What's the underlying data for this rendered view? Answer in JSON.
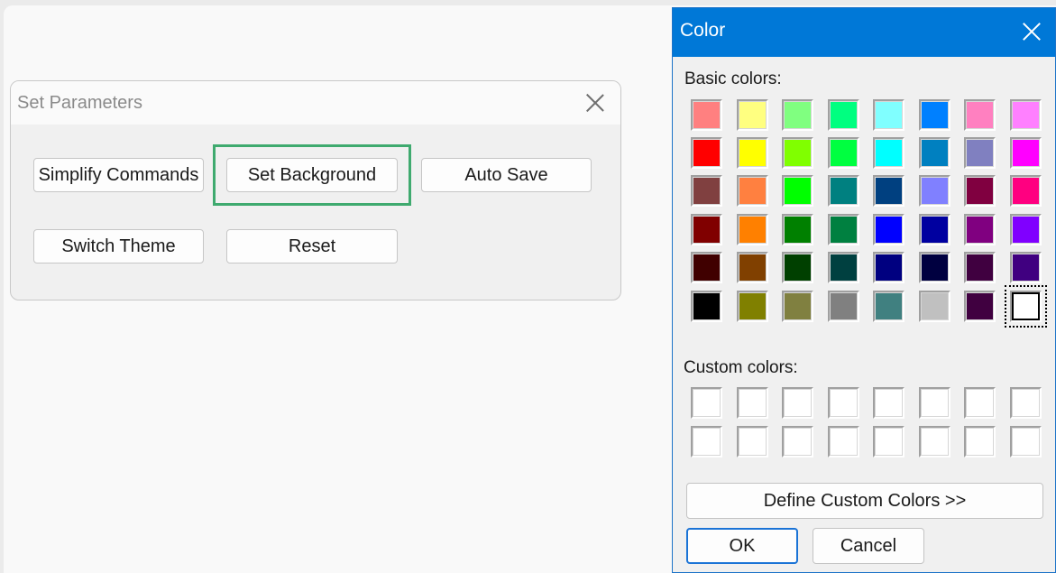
{
  "params_dialog": {
    "title": "Set Parameters",
    "buttons": {
      "simplify": "Simplify Commands",
      "background": "Set Background",
      "autosave": "Auto Save",
      "theme": "Switch Theme",
      "reset": "Reset"
    },
    "highlight_color": "#3faa6f"
  },
  "color_dialog": {
    "title": "Color",
    "title_color": "#0078d7",
    "basic_label": "Basic colors:",
    "custom_label": "Custom colors:",
    "basic_colors": [
      [
        "#ff8080",
        "#ffff80",
        "#80ff80",
        "#00ff80",
        "#80ffff",
        "#0080ff",
        "#ff80c0",
        "#ff80ff"
      ],
      [
        "#ff0000",
        "#ffff00",
        "#80ff00",
        "#00ff40",
        "#00ffff",
        "#0080c0",
        "#8080c0",
        "#ff00ff"
      ],
      [
        "#804040",
        "#ff8040",
        "#00ff00",
        "#008080",
        "#004080",
        "#8080ff",
        "#800040",
        "#ff0080"
      ],
      [
        "#800000",
        "#ff8000",
        "#008000",
        "#008040",
        "#0000ff",
        "#0000a0",
        "#800080",
        "#8000ff"
      ],
      [
        "#400000",
        "#804000",
        "#004000",
        "#004040",
        "#000080",
        "#000040",
        "#400040",
        "#400080"
      ],
      [
        "#000000",
        "#808000",
        "#808040",
        "#808080",
        "#408080",
        "#c0c0c0",
        "#400040",
        "#ffffff"
      ]
    ],
    "selected_basic": {
      "row": 5,
      "col": 7
    },
    "custom_colors": [
      [
        "#ffffff",
        "#ffffff",
        "#ffffff",
        "#ffffff",
        "#ffffff",
        "#ffffff",
        "#ffffff",
        "#ffffff"
      ],
      [
        "#ffffff",
        "#ffffff",
        "#ffffff",
        "#ffffff",
        "#ffffff",
        "#ffffff",
        "#ffffff",
        "#ffffff"
      ]
    ],
    "define_custom_label": "Define Custom Colors >>",
    "ok_label": "OK",
    "cancel_label": "Cancel"
  }
}
